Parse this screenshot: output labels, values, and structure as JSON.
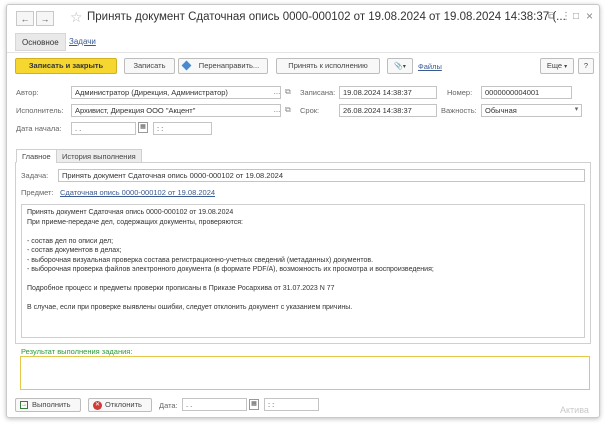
{
  "window": {
    "title": "Принять документ Сдаточная опись 0000-000102 от 19.08.2024 от 19.08.2024 14:38:37 (...",
    "back_glyph": "←",
    "forward_glyph": "→",
    "star_glyph": "☆",
    "link_icon_glyph": "⧉",
    "more_icon_glyph": "⋮",
    "restore_icon_glyph": "□",
    "close_icon_glyph": "×"
  },
  "top_tabs": {
    "main": "Основное",
    "tasks": "Задачи"
  },
  "toolbar": {
    "save_close": "Записать и закрыть",
    "save": "Записать",
    "redirect": "Перенаправить...",
    "accept": "Принять к исполнению",
    "attach_glyph": "🔗",
    "files": "Файлы",
    "more": "Еще",
    "help": "?"
  },
  "form": {
    "author_label": "Автор:",
    "author_value": "Администратор (Дирекция, Администратор)",
    "written_label": "Записана:",
    "written_value": "19.08.2024 14:38:37",
    "number_label": "Номер:",
    "number_value": "0000000004001",
    "executor_label": "Исполнитель:",
    "executor_value": "Архивист, Дирекция ООО \"Акцент\"",
    "deadline_label": "Срок:",
    "deadline_value": "26.08.2024 14:38:37",
    "importance_label": "Важность:",
    "importance_value": "Обычная",
    "start_date_label": "Дата начала:",
    "start_date_value": " .  . ",
    "start_time_value": " :  : ",
    "dots": "...",
    "dropdown_glyph": "▾"
  },
  "main_tabs": {
    "main": "Главное",
    "history": "История выполнения"
  },
  "task": {
    "task_label": "Задача:",
    "task_value": "Принять документ Сдаточная опись 0000-000102 от 19.08.2024",
    "subject_label": "Предмет:",
    "subject_link": "Сдаточная опись 0000-000102 от 19.08.2024",
    "description_lines": [
      "Принять документ Сдаточная опись 0000-000102 от 19.08.2024",
      "При приеме-передаче дел, содержащих документы, проверяются:",
      "",
      "- состав дел по описи дел;",
      "- состав документов в делах;",
      "- выборочная визуальная проверка состава регистрационно-учетных сведений (метаданных) документов.",
      "- выборочная проверка файлов электронного документа (в формате PDF/A), возможность их просмотра и воспроизведения;",
      "",
      "Подробное процесс и предметы проверки прописаны в Приказе Росархива от 31.07.2023 N 77",
      "",
      "В случае, если при проверке выявлены ошибки, следует отклонить документ с указанием причины."
    ]
  },
  "result": {
    "label": "Результат выполнения задания:"
  },
  "bottom": {
    "execute": "Выполнить",
    "reject": "Отклонить",
    "date_label": "Дата:",
    "date_value": " .  . ",
    "time_value": " :  : "
  },
  "watermark": "Актива",
  "colors": {
    "accent_yellow": "#f5d730",
    "link_blue": "#3a5a94",
    "result_green": "#2c9a3a"
  }
}
